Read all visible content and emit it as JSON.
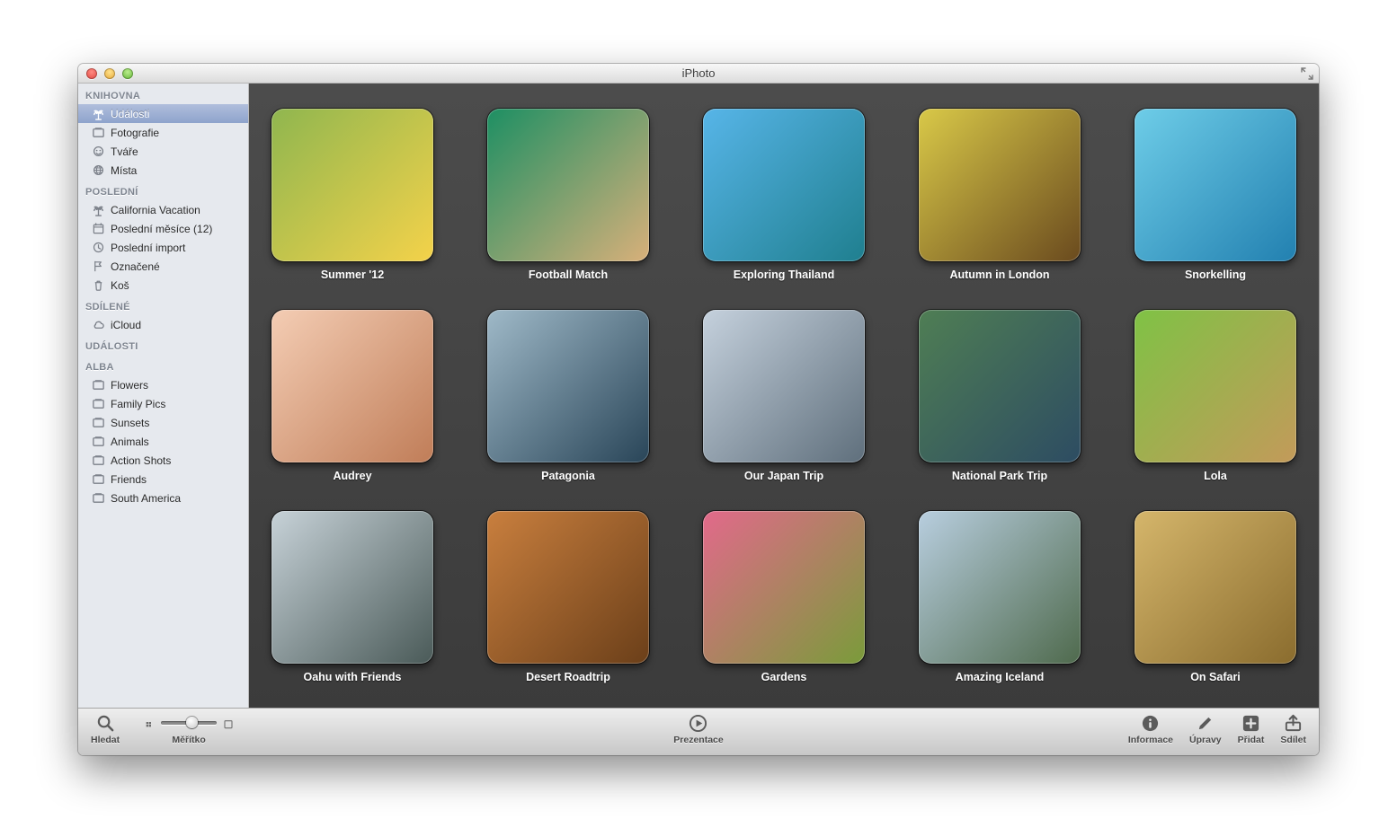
{
  "window": {
    "title": "iPhoto"
  },
  "sidebar": {
    "sections": [
      {
        "heading": "KNIHOVNA",
        "items": [
          {
            "label": "Události",
            "icon": "palm",
            "selected": true
          },
          {
            "label": "Fotografie",
            "icon": "stack"
          },
          {
            "label": "Tváře",
            "icon": "face"
          },
          {
            "label": "Místa",
            "icon": "globe"
          }
        ]
      },
      {
        "heading": "POSLEDNÍ",
        "items": [
          {
            "label": "California Vacation",
            "icon": "palm"
          },
          {
            "label": "Poslední měsíce (12)",
            "icon": "calendar"
          },
          {
            "label": "Poslední import",
            "icon": "clock"
          },
          {
            "label": "Označené",
            "icon": "flag"
          },
          {
            "label": "Koš",
            "icon": "trash"
          }
        ]
      },
      {
        "heading": "SDÍLENÉ",
        "items": [
          {
            "label": "iCloud",
            "icon": "cloud"
          }
        ]
      },
      {
        "heading": "UDÁLOSTI",
        "items": []
      },
      {
        "heading": "ALBA",
        "items": [
          {
            "label": "Flowers",
            "icon": "stack"
          },
          {
            "label": "Family Pics",
            "icon": "stack"
          },
          {
            "label": "Sunsets",
            "icon": "stack"
          },
          {
            "label": "Animals",
            "icon": "stack"
          },
          {
            "label": "Action Shots",
            "icon": "stack"
          },
          {
            "label": "Friends",
            "icon": "stack"
          },
          {
            "label": "South America",
            "icon": "stack"
          }
        ]
      }
    ]
  },
  "events": [
    {
      "label": "Summer '12",
      "c1": "#8fb64f",
      "c2": "#f4d24a"
    },
    {
      "label": "Football Match",
      "c1": "#1d8f63",
      "c2": "#d8b07a"
    },
    {
      "label": "Exploring Thailand",
      "c1": "#57b5e8",
      "c2": "#1f7f8f"
    },
    {
      "label": "Autumn in London",
      "c1": "#d9c948",
      "c2": "#6a4a1e"
    },
    {
      "label": "Snorkelling",
      "c1": "#6ecde8",
      "c2": "#2280b0"
    },
    {
      "label": "Audrey",
      "c1": "#f4cdb4",
      "c2": "#c07d58"
    },
    {
      "label": "Patagonia",
      "c1": "#9fb9c8",
      "c2": "#294558"
    },
    {
      "label": "Our Japan Trip",
      "c1": "#c5d1dd",
      "c2": "#5f6f7c"
    },
    {
      "label": "National Park Trip",
      "c1": "#4f7e54",
      "c2": "#2d4c62"
    },
    {
      "label": "Lola",
      "c1": "#7fc245",
      "c2": "#c39a5a"
    },
    {
      "label": "Oahu with Friends",
      "c1": "#c7d2d8",
      "c2": "#4a5a58"
    },
    {
      "label": "Desert Roadtrip",
      "c1": "#c97f3e",
      "c2": "#6b3f19"
    },
    {
      "label": "Gardens",
      "c1": "#e2698b",
      "c2": "#7a9b3a"
    },
    {
      "label": "Amazing Iceland",
      "c1": "#b8cedf",
      "c2": "#4f6a4d"
    },
    {
      "label": "On Safari",
      "c1": "#d5b66b",
      "c2": "#8a6c2e"
    }
  ],
  "toolbar": {
    "search": "Hledat",
    "zoom": "Měřítko",
    "slideshow": "Prezentace",
    "info": "Informace",
    "edit": "Úpravy",
    "add": "Přidat",
    "share": "Sdílet",
    "slider_pct": 55
  }
}
